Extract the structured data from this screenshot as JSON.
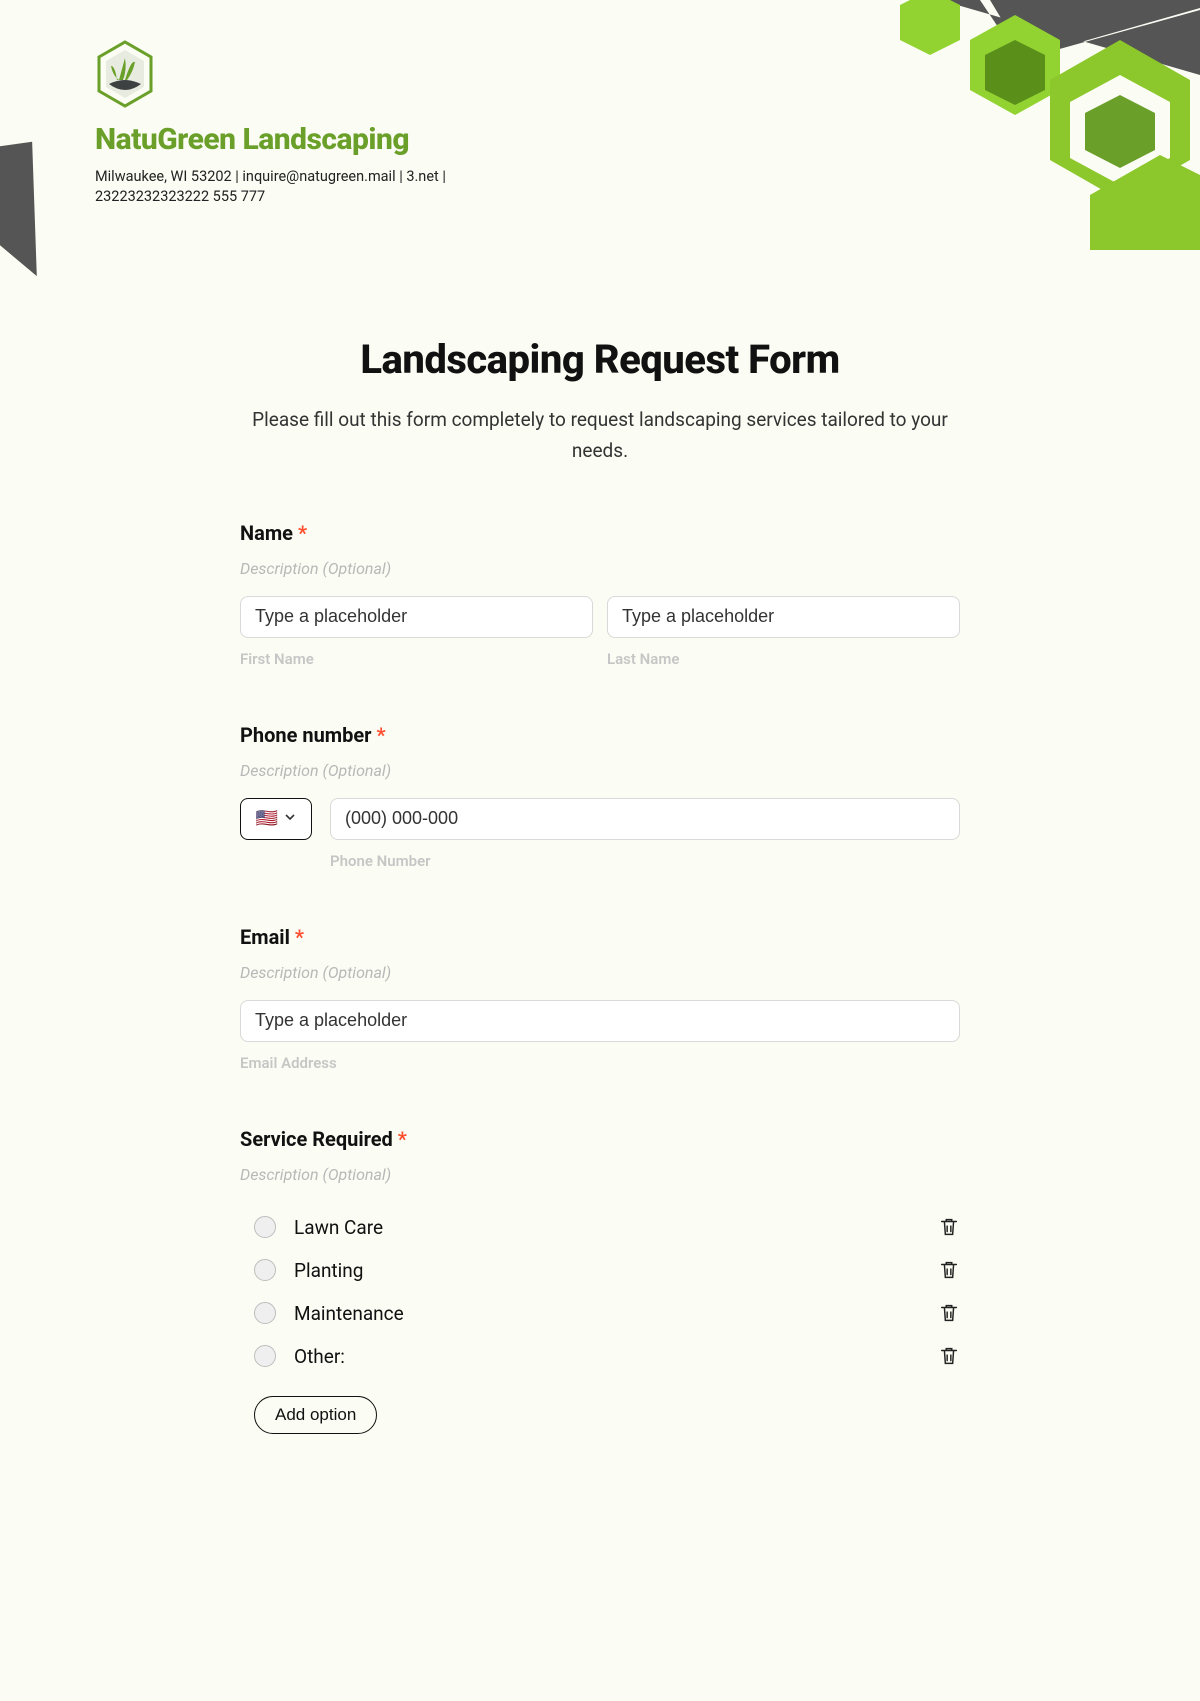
{
  "header": {
    "company_name": "NatuGreen Landscaping",
    "contact_line": "Milwaukee, WI 53202 | inquire@natugreen.mail | 3.net | 23223232323222 555 777"
  },
  "form": {
    "title": "Landscaping Request Form",
    "description": "Please fill out this form completely to request landscaping services tailored to your needs.",
    "required_star": "*",
    "optional_desc": "Description (Optional)"
  },
  "fields": {
    "name": {
      "label": "Name",
      "first_placeholder": "Type a placeholder",
      "last_placeholder": "Type a placeholder",
      "first_sub": "First Name",
      "last_sub": "Last Name"
    },
    "phone": {
      "label": "Phone number",
      "placeholder": "(000) 000-000",
      "sub": "Phone Number",
      "flag": "🇺🇸"
    },
    "email": {
      "label": "Email",
      "placeholder": "Type a placeholder",
      "sub": "Email Address"
    },
    "service": {
      "label": "Service Required",
      "options": [
        "Lawn Care",
        "Planting",
        "Maintenance",
        "Other:"
      ],
      "add_button": "Add option"
    }
  }
}
